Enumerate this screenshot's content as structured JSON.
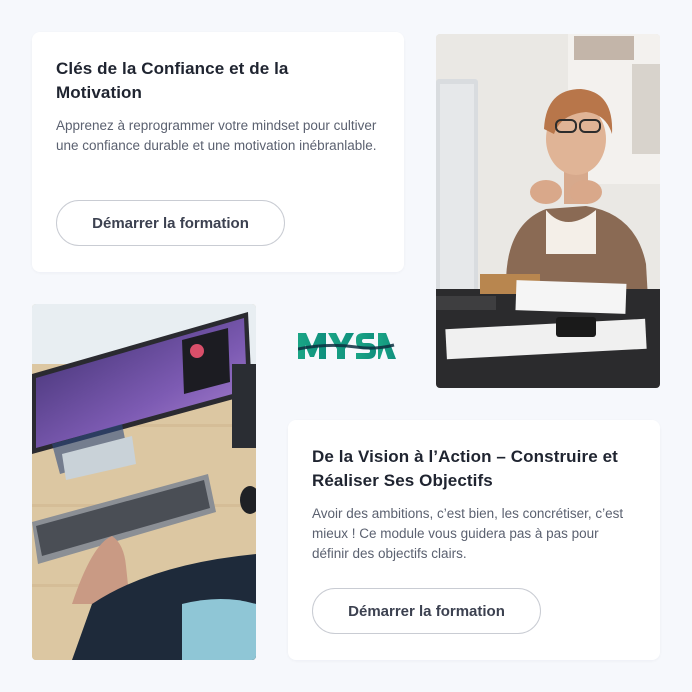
{
  "card1": {
    "title": "Clés de la Confiance et de la Motivation",
    "description": "Apprenez à reprogrammer votre mindset pour cultiver une confiance durable et une motivation inébranlable.",
    "button_label": "Démarrer la formation"
  },
  "card2": {
    "title": "De la Vision à l’Action – Construire et Réaliser Ses Objectifs",
    "description": "Avoir des ambitions, c’est bien, les concrétiser, c’est mieux ! Ce module vous guidera pas à pas pour définir des objectifs clairs.",
    "button_label": "Démarrer la formation"
  },
  "logo": {
    "text": "MYSA",
    "color": "#1aa585"
  },
  "colors": {
    "background": "#f6f8fc",
    "card": "#ffffff",
    "title": "#1f2430",
    "body_text": "#5b6170",
    "button_border": "#c9ccd3"
  }
}
